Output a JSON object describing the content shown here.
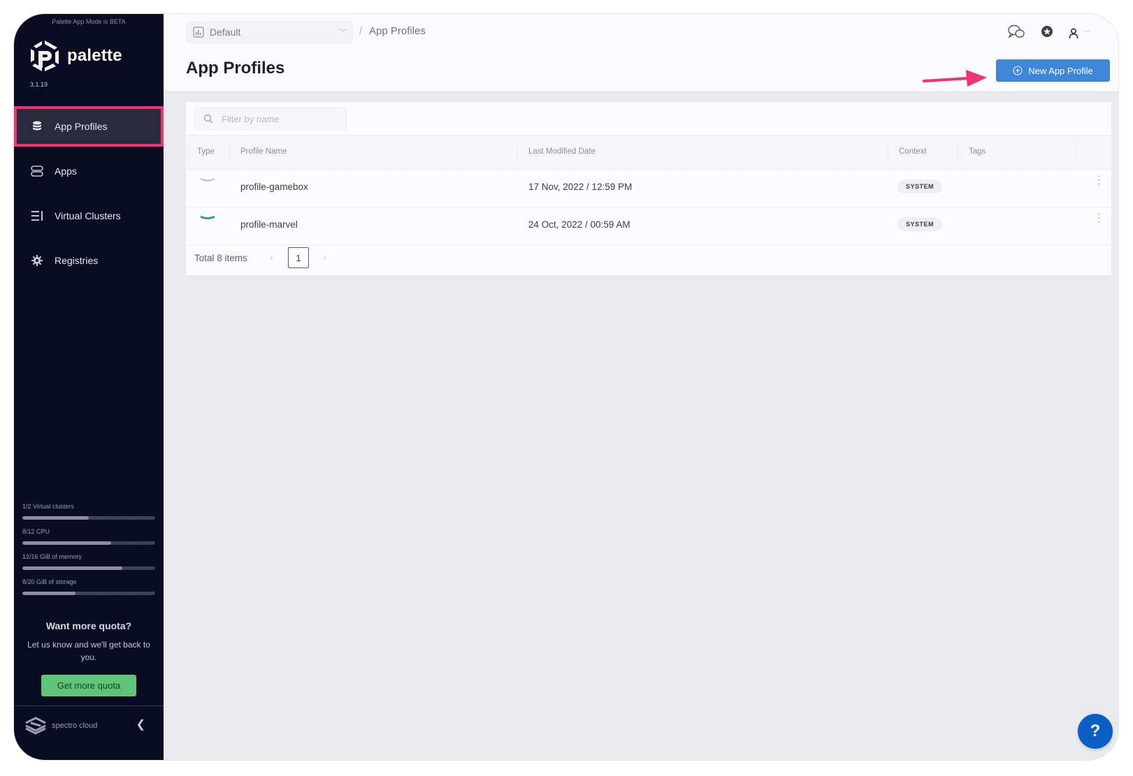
{
  "sidebar": {
    "beta_notice": "Palette App Mode is BETA",
    "logo_text": "palette",
    "version": "3.1.19",
    "nav": [
      {
        "label": "App Profiles",
        "icon": "database-icon",
        "active": true
      },
      {
        "label": "Apps",
        "icon": "server-stack-icon",
        "active": false
      },
      {
        "label": "Virtual Clusters",
        "icon": "cluster-list-icon",
        "active": false
      },
      {
        "label": "Registries",
        "icon": "gear-icon",
        "active": false
      }
    ],
    "quota": [
      {
        "label": "1/2 Virtual clusters",
        "fraction": 0.5
      },
      {
        "label": "8/12 CPU",
        "fraction": 0.667
      },
      {
        "label": "12/16 GiB of memory",
        "fraction": 0.75
      },
      {
        "label": "8/20 GiB of storage",
        "fraction": 0.4
      }
    ],
    "more_quota": {
      "title": "Want more quota?",
      "text": "Let us know and we'll get back to you.",
      "button": "Get more quota"
    },
    "brand": "spectro cloud",
    "collapse_icon": "chevron-left-icon"
  },
  "header": {
    "scope": "Default",
    "breadcrumb_sep": "/",
    "breadcrumb": "App Profiles",
    "title": "App Profiles",
    "new_button": "New App Profile",
    "icons": [
      "chat-icon",
      "star-badge-icon",
      "user-icon",
      "chevron-down-icon"
    ]
  },
  "table": {
    "filter_placeholder": "Filter by name",
    "columns": [
      "Type",
      "Profile Name",
      "Last Modified Date",
      "Context",
      "Tags"
    ],
    "rows": [
      {
        "type_color": "#b9bcc4",
        "name": "profile-gamebox",
        "modified": "17 Nov, 2022 / 12:59 PM",
        "context": "SYSTEM",
        "tags": ""
      },
      {
        "type_color": "#3f9a86",
        "name": "profile-marvel",
        "modified": "24 Oct, 2022 / 00:59 AM",
        "context": "SYSTEM",
        "tags": ""
      }
    ],
    "total": "Total 8 items",
    "page": "1",
    "prev": "‹",
    "next": "›"
  },
  "colors": {
    "accent": "#3d86d8",
    "highlight": "#f0336e",
    "sidebar_bg": "#0a0c24",
    "quota_button": "#5ec578",
    "help": "#0a5fc7"
  },
  "help_label": "?"
}
